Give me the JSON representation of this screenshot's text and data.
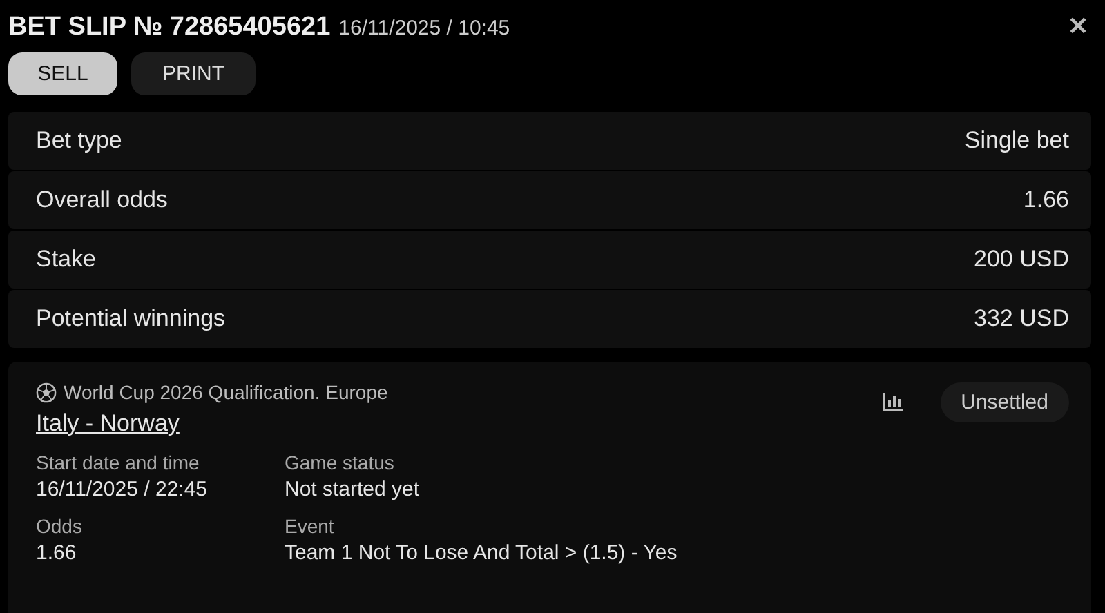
{
  "header": {
    "title": "BET SLIP № 72865405621",
    "datetime": "16/11/2025 / 10:45",
    "close": "✕"
  },
  "actions": [
    {
      "label": "SELL",
      "selected": true
    },
    {
      "label": "PRINT",
      "selected": false
    }
  ],
  "summary": [
    {
      "label": "Bet type",
      "value": "Single bet"
    },
    {
      "label": "Overall odds",
      "value": "1.66"
    },
    {
      "label": "Stake",
      "value": "200 USD"
    },
    {
      "label": "Potential winnings",
      "value": "332 USD"
    }
  ],
  "bet": {
    "competition": "World Cup 2026 Qualification. Europe",
    "match": "Italy - Norway",
    "status_badge": "Unsettled",
    "details": [
      {
        "label": "Start date and time",
        "value": "16/11/2025 / 22:45"
      },
      {
        "label": "Game status",
        "value": "Not started yet"
      },
      {
        "label": "Odds",
        "value": "1.66"
      },
      {
        "label": "Event",
        "value": "Team 1 Not To Lose And Total > (1.5) - Yes"
      }
    ]
  }
}
